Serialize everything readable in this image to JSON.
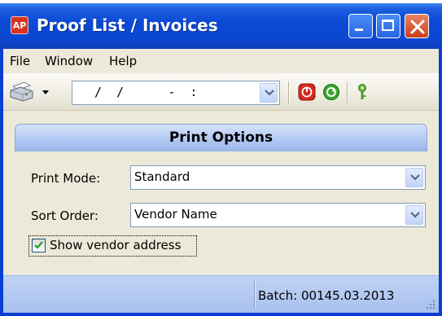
{
  "window": {
    "title": "Proof List / Invoices",
    "app_icon_text": "AP",
    "title_bar_color": "#0a47d2",
    "close_button_color": "#c9401d"
  },
  "menu": {
    "items": [
      "File",
      "Window",
      "Help"
    ]
  },
  "toolbar": {
    "date_value": " /  /      -  :",
    "icons": [
      "printer-icon",
      "dropdown-arrow-icon",
      "stop-icon",
      "go-icon",
      "key-icon"
    ]
  },
  "panel": {
    "title": "Print Options",
    "header_color": "#b5cbf3",
    "print_mode": {
      "label": "Print Mode:",
      "value": "Standard"
    },
    "sort_order": {
      "label": "Sort Order:",
      "value": "Vendor Name"
    },
    "show_vendor_address": {
      "label": "Show vendor address",
      "checked": true
    }
  },
  "status": {
    "batch": "Batch: 00145.03.2013"
  }
}
